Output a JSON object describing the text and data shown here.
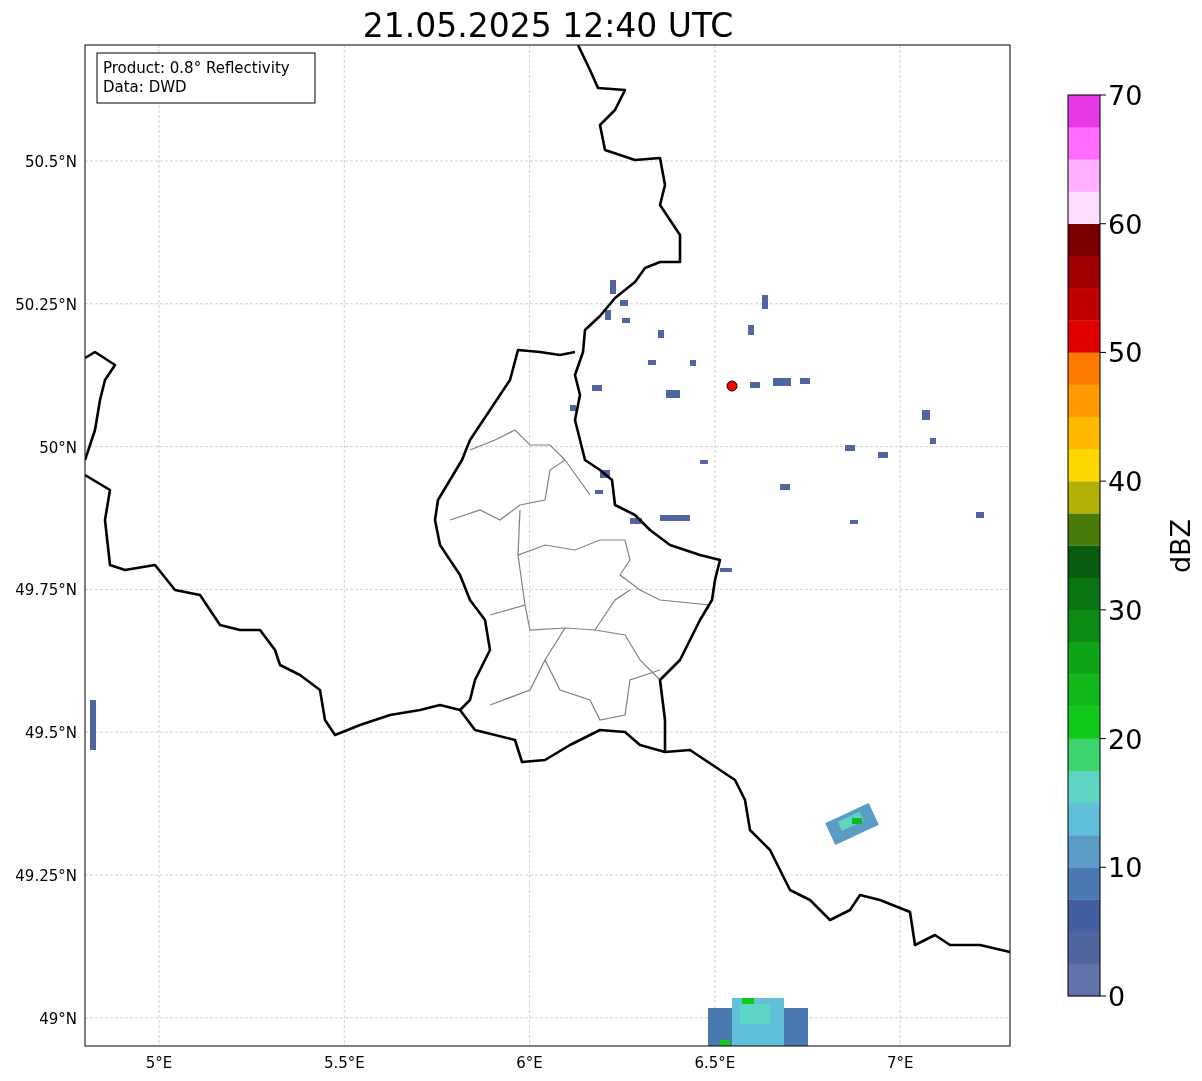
{
  "title": "21.05.2025 12:40 UTC",
  "annotation": [
    "Product: 0.8° Reflectivity",
    "Data: DWD"
  ],
  "x_ticks": [
    "5°E",
    "5.5°E",
    "6°E",
    "6.5°E",
    "7°E"
  ],
  "y_ticks": [
    "50.5°N",
    "50.25°N",
    "50°N",
    "49.75°N",
    "49.5°N",
    "49.25°N",
    "49°N"
  ],
  "colorbar": {
    "label": "dBZ",
    "ticks": [
      "70",
      "60",
      "50",
      "40",
      "30",
      "20",
      "10",
      "0"
    ]
  }
}
